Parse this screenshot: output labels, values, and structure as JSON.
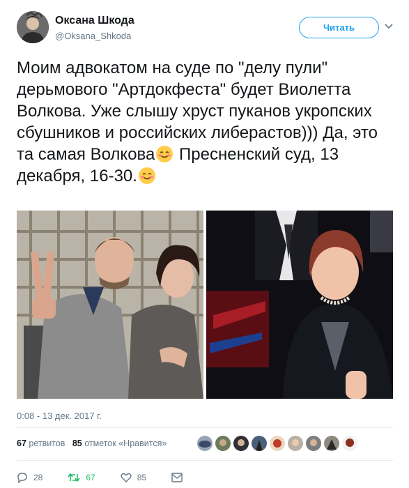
{
  "author": {
    "name": "Оксана Шкода",
    "handle": "@Oksana_Shkoda",
    "follow_label": "Читать"
  },
  "tweet": {
    "text_part1": "Моим адвокатом на суде по \"делу пули\" дерьмового \"Артдокфеста\" будет Виолетта Волкова. Уже слышу хруст пуканов укропских сбушников и российских либерастов))) Да, это та самая Волкова",
    "text_part2": " Пресненский суд, 13 декабря, 16-30.",
    "emoji": "smiling-face-with-smiling-eyes"
  },
  "timestamp": "0:08 - 13 дек. 2017 г.",
  "stats": {
    "retweets_count": "67",
    "retweets_label": "ретвитов",
    "likes_count": "85",
    "likes_label": "отметок «Нравится»"
  },
  "actions": {
    "reply_count": "28",
    "retweet_count": "67",
    "like_count": "85"
  },
  "colors": {
    "accent": "#1da1f2",
    "retweet": "#17bf63",
    "muted": "#657786"
  }
}
